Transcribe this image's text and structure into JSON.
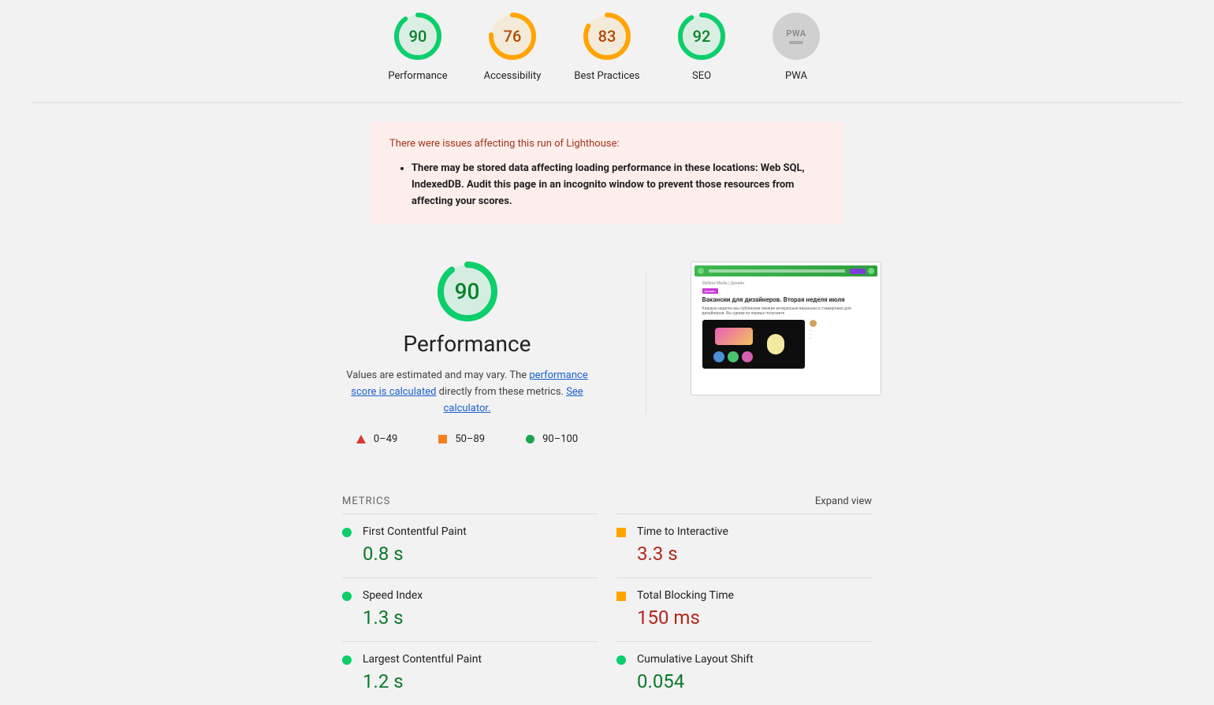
{
  "gauges": [
    {
      "score": "90",
      "label": "Performance",
      "status": "green"
    },
    {
      "score": "76",
      "label": "Accessibility",
      "status": "orange"
    },
    {
      "score": "83",
      "label": "Best Practices",
      "status": "orange"
    },
    {
      "score": "92",
      "label": "SEO",
      "status": "green"
    }
  ],
  "pwa_label": "PWA",
  "pwa_badge": "PWA",
  "warning": {
    "title": "There were issues affecting this run of Lighthouse:",
    "items": [
      "There may be stored data affecting loading performance in these locations: Web SQL, IndexedDB. Audit this page in an incognito window to prevent those resources from affecting your scores."
    ]
  },
  "performance": {
    "score": "90",
    "title": "Performance",
    "desc_prefix": "Values are estimated and may vary. The ",
    "link1": "performance score is calculated",
    "desc_mid": " directly from these metrics. ",
    "link2": "See calculator."
  },
  "legend": [
    {
      "range": "0–49"
    },
    {
      "range": "50–89"
    },
    {
      "range": "90–100"
    }
  ],
  "preview": {
    "crumb": "Skillbox Media | Дизайн",
    "tag": "Дизайн",
    "heading": "Вакансии для дизайнеров. Вторая неделя июля",
    "para": "Каждую неделю мы публикуем свежие интересные вакансии и стажировки для дизайнеров. Вы одним из первых получаете"
  },
  "metrics_title": "METRICS",
  "expand_label": "Expand view",
  "metrics": [
    {
      "name": "First Contentful Paint",
      "value": "0.8 s",
      "status": "green"
    },
    {
      "name": "Time to Interactive",
      "value": "3.3 s",
      "status": "orange"
    },
    {
      "name": "Speed Index",
      "value": "1.3 s",
      "status": "green"
    },
    {
      "name": "Total Blocking Time",
      "value": "150 ms",
      "status": "orange"
    },
    {
      "name": "Largest Contentful Paint",
      "value": "1.2 s",
      "status": "green"
    },
    {
      "name": "Cumulative Layout Shift",
      "value": "0.054",
      "status": "green"
    }
  ],
  "colors": {
    "green": "#0cce6b",
    "orange": "#ffa400",
    "red": "#ff4e42"
  }
}
